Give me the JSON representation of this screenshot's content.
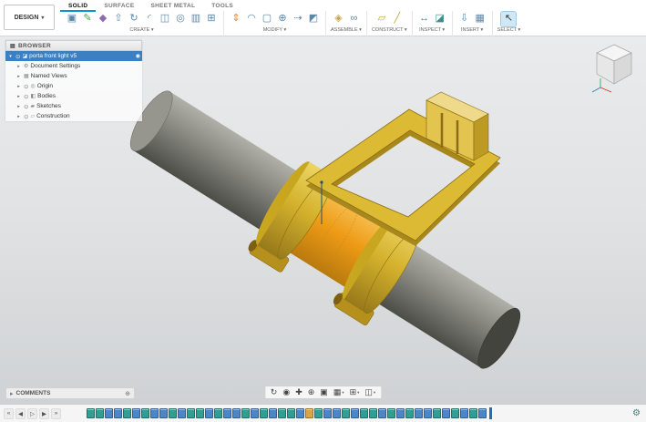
{
  "icons": {
    "caret_down": "▾",
    "caret_right": "▸",
    "eye": "⊙",
    "gear": "⚙",
    "radio": "◉",
    "panel": "▤",
    "add_comment": "⊕"
  },
  "header": {
    "workspace": {
      "label": "DESIGN"
    },
    "group_caret": "▾",
    "tabs": [
      {
        "label": "SOLID",
        "active": true
      },
      {
        "label": "SURFACE",
        "active": false
      },
      {
        "label": "SHEET METAL",
        "active": false
      },
      {
        "label": "TOOLS",
        "active": false
      }
    ],
    "groups": [
      {
        "label": "CREATE",
        "icons": [
          {
            "name": "new-component",
            "glyph": "▣",
            "color": "#5b87a8"
          },
          {
            "name": "create-sketch",
            "glyph": "✎",
            "color": "#4a9e4f"
          },
          {
            "name": "create-form",
            "glyph": "◆",
            "color": "#8e6bb0"
          },
          {
            "name": "extrude",
            "glyph": "⇧",
            "color": "#5b87a8"
          },
          {
            "name": "revolve",
            "glyph": "↻",
            "color": "#5b87a8"
          },
          {
            "name": "sweep",
            "glyph": "◜",
            "color": "#5b87a8"
          },
          {
            "name": "loft",
            "glyph": "◫",
            "color": "#5b87a8"
          },
          {
            "name": "hole",
            "glyph": "◎",
            "color": "#5b87a8"
          },
          {
            "name": "box-primitive",
            "glyph": "▥",
            "color": "#5b87a8"
          },
          {
            "name": "cylinder-primitive",
            "glyph": "⊞",
            "color": "#5b87a8"
          }
        ]
      },
      {
        "label": "MODIFY",
        "icons": [
          {
            "name": "press-pull",
            "glyph": "⇕",
            "color": "#e08a2e"
          },
          {
            "name": "fillet",
            "glyph": "◠",
            "color": "#5b87a8"
          },
          {
            "name": "shell",
            "glyph": "▢",
            "color": "#5b87a8"
          },
          {
            "name": "combine",
            "glyph": "⊕",
            "color": "#5b87a8"
          },
          {
            "name": "offset-face",
            "glyph": "⇢",
            "color": "#5b87a8"
          },
          {
            "name": "split-body",
            "glyph": "◩",
            "color": "#5b87a8"
          }
        ]
      },
      {
        "label": "ASSEMBLE",
        "icons": [
          {
            "name": "assemble-new-component",
            "glyph": "◈",
            "color": "#c8a53a"
          },
          {
            "name": "joint",
            "glyph": "∞",
            "color": "#5b87a8"
          }
        ]
      },
      {
        "label": "CONSTRUCT",
        "icons": [
          {
            "name": "construction-plane",
            "glyph": "▱",
            "color": "#c8a53a"
          },
          {
            "name": "construction-axis",
            "glyph": "╱",
            "color": "#c8a53a"
          }
        ]
      },
      {
        "label": "INSPECT",
        "icons": [
          {
            "name": "measure",
            "glyph": "↔",
            "color": "#3a8e8a"
          },
          {
            "name": "section-analysis",
            "glyph": "◪",
            "color": "#3a8e8a"
          }
        ]
      },
      {
        "label": "INSERT",
        "icons": [
          {
            "name": "insert-derive",
            "glyph": "⇩",
            "color": "#5b87a8"
          },
          {
            "name": "insert-mesh",
            "glyph": "▦",
            "color": "#5b87a8"
          }
        ]
      },
      {
        "label": "SELECT",
        "icons": [
          {
            "name": "select-tool",
            "glyph": "↖",
            "color": "#333333",
            "active": true
          }
        ]
      }
    ]
  },
  "browser": {
    "title": "BROWSER",
    "items": [
      {
        "label": "porta front light v5",
        "selected": true,
        "caret": "down",
        "icon": "component",
        "icon_glyph": "◪",
        "has_eye": true,
        "has_radio": true,
        "level": 0
      },
      {
        "label": "Document Settings",
        "selected": false,
        "caret": "right",
        "icon": "settings",
        "icon_glyph": "⚙",
        "has_eye": false,
        "has_radio": false,
        "level": 1
      },
      {
        "label": "Named Views",
        "selected": false,
        "caret": "right",
        "icon": "named-views",
        "icon_glyph": "▦",
        "has_eye": false,
        "has_radio": false,
        "level": 1
      },
      {
        "label": "Origin",
        "selected": false,
        "caret": "right",
        "icon": "origin",
        "icon_glyph": "◎",
        "has_eye": true,
        "has_radio": false,
        "level": 1
      },
      {
        "label": "Bodies",
        "selected": false,
        "caret": "right",
        "icon": "bodies",
        "icon_glyph": "◧",
        "has_eye": true,
        "has_radio": false,
        "level": 1
      },
      {
        "label": "Sketches",
        "selected": false,
        "caret": "right",
        "icon": "sketches",
        "icon_glyph": "▰",
        "has_eye": true,
        "has_radio": false,
        "level": 1
      },
      {
        "label": "Construction",
        "selected": false,
        "caret": "right",
        "icon": "construction",
        "icon_glyph": "▱",
        "has_eye": true,
        "has_radio": false,
        "level": 1
      }
    ]
  },
  "canvas": {
    "comments_label": "COMMENTS"
  },
  "navbar": {
    "items": [
      {
        "name": "orbit",
        "glyph": "↻",
        "caret": false
      },
      {
        "name": "look-at",
        "glyph": "◉",
        "caret": false
      },
      {
        "name": "pan",
        "glyph": "✚",
        "caret": false
      },
      {
        "name": "zoom",
        "glyph": "⊕",
        "caret": false
      },
      {
        "name": "fit",
        "glyph": "▣",
        "caret": false
      },
      {
        "name": "display-settings",
        "glyph": "▦",
        "caret": true
      },
      {
        "name": "grid-and-snaps",
        "glyph": "⊞",
        "caret": true
      },
      {
        "name": "viewports",
        "glyph": "◫",
        "caret": true
      }
    ]
  },
  "timeline": {
    "controls": [
      {
        "name": "go-to-beginning",
        "glyph": "«"
      },
      {
        "name": "step-back",
        "glyph": "◀"
      },
      {
        "name": "play",
        "glyph": "▷"
      },
      {
        "name": "step-forward",
        "glyph": "▶"
      },
      {
        "name": "go-to-end",
        "glyph": "»"
      }
    ],
    "features": [
      "sketch",
      "sketch",
      "extrude",
      "extrude",
      "sketch",
      "extrude",
      "sketch",
      "extrude",
      "extrude",
      "sketch",
      "extrude",
      "sketch",
      "sketch",
      "extrude",
      "sketch",
      "extrude",
      "extrude",
      "sketch",
      "extrude",
      "sketch",
      "extrude",
      "sketch",
      "sketch",
      "extrude",
      "plane",
      "sketch",
      "extrude",
      "extrude",
      "sketch",
      "extrude",
      "sketch",
      "sketch",
      "extrude",
      "sketch",
      "extrude",
      "sketch",
      "extrude",
      "extrude",
      "sketch",
      "extrude",
      "sketch",
      "extrude",
      "sketch",
      "extrude"
    ],
    "feature_colors": {
      "sketch": "#2f9e93",
      "extrude": "#4a86c8",
      "plane": "#d9a441"
    }
  },
  "colors": {
    "accent_blue": "#0696d7",
    "selection_highlight_orange": "#ee9b16",
    "model_yellow": "#d4b12c",
    "tube_gray": "#8f8f88",
    "canvas_top": "#e9ebec",
    "canvas_bottom": "#cfd2d4"
  }
}
